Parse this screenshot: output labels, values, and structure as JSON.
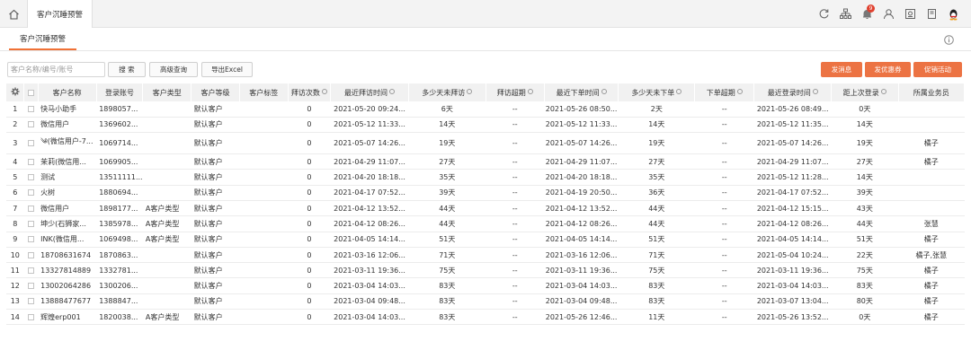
{
  "tab_title": "客户沉睡预警",
  "subtab_title": "客户沉睡预警",
  "notification_count": "9",
  "icons": [
    "refresh-icon",
    "sitemap-icon",
    "bell-icon",
    "user-icon",
    "screen-icon",
    "book-icon",
    "qq-avatar-icon"
  ],
  "search": {
    "placeholder": "客户名称/编号/账号"
  },
  "buttons": {
    "search": "搜 索",
    "advanced": "高级查询",
    "export": "导出Excel",
    "send_msg": "发消息",
    "send_coupon": "发优惠券",
    "promo": "促销活动"
  },
  "colors": {
    "accent": "#ec7343",
    "badge": "#e0412f"
  },
  "table": {
    "headers": [
      "客户名称",
      "登录账号",
      "客户类型",
      "客户等级",
      "客户标签",
      "拜访次数",
      "最近拜访时间",
      "多少天未拜访",
      "拜访超期",
      "最近下单时间",
      "多少天未下单",
      "下单超期",
      "最近登录时间",
      "距上次登录",
      "所属业务员"
    ],
    "rows": [
      [
        "1",
        "快马小助手",
        "1898057...",
        "",
        "默认客户",
        "",
        "0",
        "2021-05-20 09:24...",
        "6天",
        "--",
        "2021-05-26 08:50...",
        "2天",
        "--",
        "2021-05-26 08:49...",
        "0天",
        ""
      ],
      [
        "2",
        "微信用户",
        "1369602...",
        "",
        "默认客户",
        "",
        "0",
        "2021-05-12 11:33...",
        "14天",
        "--",
        "2021-05-12 11:33...",
        "14天",
        "--",
        "2021-05-12 11:35...",
        "14天",
        ""
      ],
      [
        "3",
        "༄(微信用户-7...",
        "1069714...",
        "",
        "默认客户",
        "",
        "0",
        "2021-05-07 14:26...",
        "19天",
        "--",
        "2021-05-07 14:26...",
        "19天",
        "--",
        "2021-05-07 14:26...",
        "19天",
        "橘子"
      ],
      [
        "4",
        "茉莉(微信用...",
        "1069905...",
        "",
        "默认客户",
        "",
        "0",
        "2021-04-29 11:07...",
        "27天",
        "--",
        "2021-04-29 11:07...",
        "27天",
        "--",
        "2021-04-29 11:07...",
        "27天",
        "橘子"
      ],
      [
        "5",
        "测试",
        "13511111...",
        "",
        "默认客户",
        "",
        "0",
        "2021-04-20 18:18...",
        "35天",
        "--",
        "2021-04-20 18:18...",
        "35天",
        "--",
        "2021-05-12 11:28...",
        "14天",
        ""
      ],
      [
        "6",
        "火树",
        "1880694...",
        "",
        "默认客户",
        "",
        "0",
        "2021-04-17 07:52...",
        "39天",
        "--",
        "2021-04-19 20:50...",
        "36天",
        "--",
        "2021-04-17 07:52...",
        "39天",
        ""
      ],
      [
        "7",
        "微信用户",
        "1898177...",
        "A客户类型",
        "默认客户",
        "",
        "0",
        "2021-04-12 13:52...",
        "44天",
        "--",
        "2021-04-12 13:52...",
        "44天",
        "--",
        "2021-04-12 15:15...",
        "43天",
        ""
      ],
      [
        "8",
        "坤少(石狮家...",
        "1385978...",
        "A客户类型",
        "默认客户",
        "",
        "0",
        "2021-04-12 08:26...",
        "44天",
        "--",
        "2021-04-12 08:26...",
        "44天",
        "--",
        "2021-04-12 08:26...",
        "44天",
        "张慧"
      ],
      [
        "9",
        "INK(微信用...",
        "1069498...",
        "A客户类型",
        "默认客户",
        "",
        "0",
        "2021-04-05 14:14...",
        "51天",
        "--",
        "2021-04-05 14:14...",
        "51天",
        "--",
        "2021-04-05 14:14...",
        "51天",
        "橘子"
      ],
      [
        "10",
        "18708631674",
        "1870863...",
        "",
        "默认客户",
        "",
        "0",
        "2021-03-16 12:06...",
        "71天",
        "--",
        "2021-03-16 12:06...",
        "71天",
        "--",
        "2021-05-04 10:24...",
        "22天",
        "橘子,张慧"
      ],
      [
        "11",
        "13327814889",
        "1332781...",
        "",
        "默认客户",
        "",
        "0",
        "2021-03-11 19:36...",
        "75天",
        "--",
        "2021-03-11 19:36...",
        "75天",
        "--",
        "2021-03-11 19:36...",
        "75天",
        "橘子"
      ],
      [
        "12",
        "13002064286",
        "1300206...",
        "",
        "默认客户",
        "",
        "0",
        "2021-03-04 14:03...",
        "83天",
        "--",
        "2021-03-04 14:03...",
        "83天",
        "--",
        "2021-03-04 14:03...",
        "83天",
        "橘子"
      ],
      [
        "13",
        "13888477677",
        "1388847...",
        "",
        "默认客户",
        "",
        "0",
        "2021-03-04 09:48...",
        "83天",
        "--",
        "2021-03-04 09:48...",
        "83天",
        "--",
        "2021-03-07 13:04...",
        "80天",
        "橘子"
      ],
      [
        "14",
        "辉煌erp001",
        "1820038...",
        "A客户类型",
        "默认客户",
        "",
        "0",
        "2021-03-04 14:03...",
        "83天",
        "--",
        "2021-05-26 12:46...",
        "11天",
        "--",
        "2021-05-26 13:52...",
        "0天",
        "橘子"
      ]
    ]
  }
}
